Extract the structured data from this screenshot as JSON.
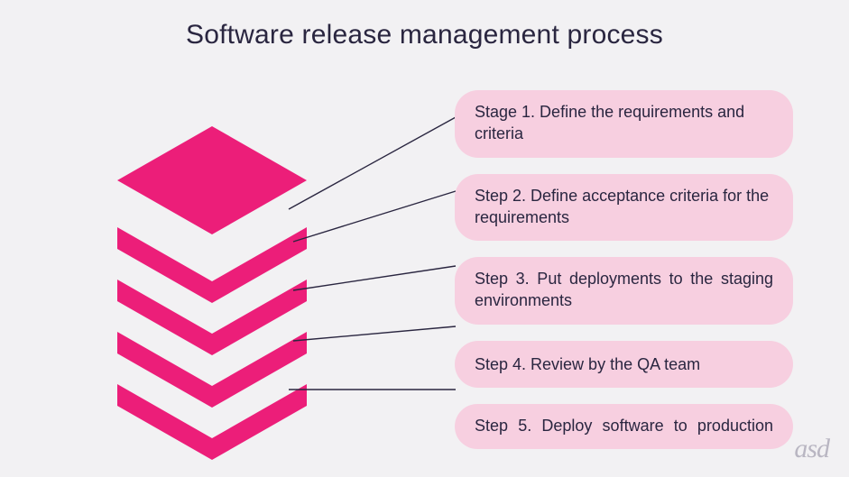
{
  "title": "Software release management process",
  "colors": {
    "accent": "#ec1e79",
    "step_bg": "#f7cfe0",
    "text": "#2a2640",
    "page_bg": "#f2f1f3",
    "logo": "#b9b6c2"
  },
  "steps": [
    {
      "label": "Stage 1. Define the requirements and criteria"
    },
    {
      "label": "Step 2. Define acceptance criteria for the requirements"
    },
    {
      "label": "Step 3. Put deployments to the staging environments"
    },
    {
      "label": "Step 4. Review by the QA team"
    },
    {
      "label": "Step 5. Deploy software to production"
    }
  ],
  "logo": "asd",
  "stack_layer_count": 5
}
